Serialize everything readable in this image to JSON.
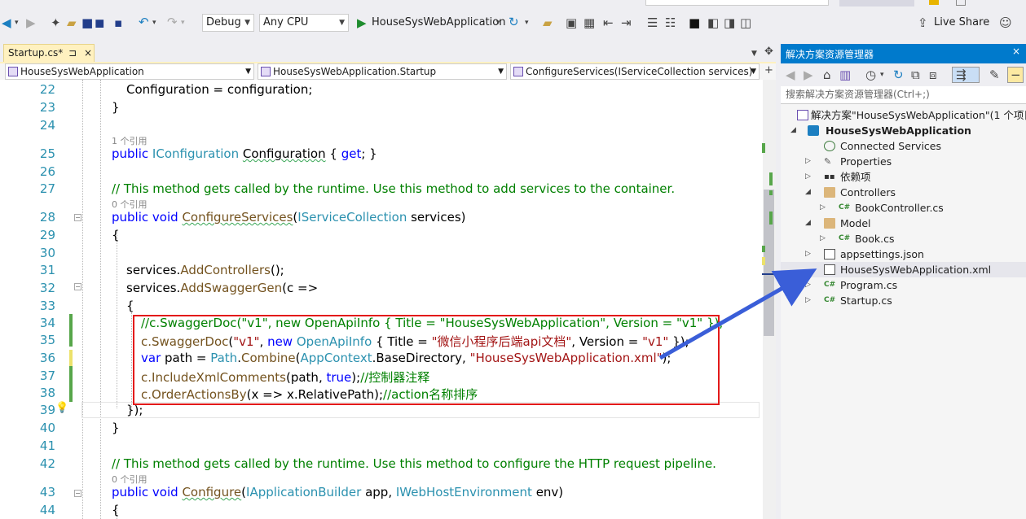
{
  "toolbar": {
    "config": "Debug",
    "platform": "Any CPU",
    "run_target": "HouseSysWebApplication",
    "live_share": "Live Share"
  },
  "tab": {
    "name": "Startup.cs*",
    "pin": "⊐",
    "close": "×"
  },
  "navbar": {
    "project": "HouseSysWebApplication",
    "class": "HouseSysWebApplication.Startup",
    "member": "ConfigureServices(IServiceCollection services)"
  },
  "code": {
    "ln22": "22",
    "l22_text": "Configuration = configuration;",
    "ln23": "23",
    "l23_text": "}",
    "ln24": "24",
    "ref1": "1 个引用",
    "ln25": "25",
    "l25_public": "public",
    "l25_type": "IConfiguration",
    "l25_name": "Configuration",
    "l25_open": " { ",
    "l25_get": "get",
    "l25_close": "; }",
    "ln26": "26",
    "ln27": "27",
    "l27_comment": "// This method gets called by the runtime. Use this method to add services to the container.",
    "ref2": "0 个引用",
    "ln28": "28",
    "l28_public": "public",
    "l28_void": "void",
    "l28_method": "ConfigureServices",
    "l28_paren": "(",
    "l28_type": "IServiceCollection",
    "l28_param": " services)",
    "ln29": "29",
    "l29_text": "{",
    "ln30": "30",
    "ln31": "31",
    "l31_pre": "services.",
    "l31_method": "AddControllers",
    "l31_post": "();",
    "ln32": "32",
    "l32_pre": "services.",
    "l32_method": "AddSwaggerGen",
    "l32_post": "(c =>",
    "ln33": "33",
    "l33_text": "{",
    "ln34": "34",
    "l34_comment": "//c.SwaggerDoc(\"v1\", new OpenApiInfo { Title = \"HouseSysWebApplication\", Version = \"v1\" });",
    "ln35": "35",
    "l35_c": "c.",
    "l35_method": "SwaggerDoc",
    "l35_p1": "(",
    "l35_s1": "\"v1\"",
    "l35_p2": ", ",
    "l35_new": "new",
    "l35_sp": " ",
    "l35_type": "OpenApiInfo",
    "l35_p3": " { Title = ",
    "l35_s2": "\"微信小程序后端api文档\"",
    "l35_p4": ", Version = ",
    "l35_s3": "\"v1\"",
    "l35_p5": " });",
    "ln36": "36",
    "l36_var": "var",
    "l36_p1": " path = ",
    "l36_type": "Path",
    "l36_dot": ".",
    "l36_method": "Combine",
    "l36_p2": "(",
    "l36_type2": "AppContext",
    "l36_p3": ".BaseDirectory, ",
    "l36_str": "\"HouseSysWebApplication.xml\"",
    "l36_p4": ");",
    "ln37": "37",
    "l37_c": "c.",
    "l37_method": "IncludeXmlComments",
    "l37_p1": "(path, ",
    "l37_true": "true",
    "l37_p2": ");",
    "l37_comment": "//控制器注释",
    "ln38": "38",
    "l38_c": "c.",
    "l38_method": "OrderActionsBy",
    "l38_p1": "(x => x.RelativePath);",
    "l38_comment": "//action名称排序",
    "ln39": "39",
    "l39_text": "});",
    "ln40": "40",
    "l40_text": "}",
    "ln41": "41",
    "ln42": "42",
    "l42_comment": "// This method gets called by the runtime. Use this method to configure the HTTP request pipeline.",
    "ref3": "0 个引用",
    "ln43": "43",
    "l43_public": "public",
    "l43_void": "void",
    "l43_method": "Configure",
    "l43_p1": "(",
    "l43_type1": "IApplicationBuilder",
    "l43_p2": " app, ",
    "l43_type2": "IWebHostEnvironment",
    "l43_p3": " env)",
    "ln44": "44",
    "l44_text": "{"
  },
  "solution_explorer": {
    "title": "解决方案资源管理器",
    "search_placeholder": "搜索解决方案资源管理器(Ctrl+;)",
    "items": [
      {
        "label": "解决方案\"HouseSysWebApplication\"(1 个项目/共 1 个)"
      },
      {
        "label": "HouseSysWebApplication"
      },
      {
        "label": "Connected Services"
      },
      {
        "label": "Properties"
      },
      {
        "label": "依赖项"
      },
      {
        "label": "Controllers"
      },
      {
        "label": "BookController.cs"
      },
      {
        "label": "Model"
      },
      {
        "label": "Book.cs"
      },
      {
        "label": "appsettings.json"
      },
      {
        "label": "HouseSysWebApplication.xml"
      },
      {
        "label": "Program.cs"
      },
      {
        "label": "Startup.cs"
      }
    ]
  },
  "annotation": {
    "box_color": "#e31a1a",
    "arrow_color": "#3a5ed8"
  }
}
